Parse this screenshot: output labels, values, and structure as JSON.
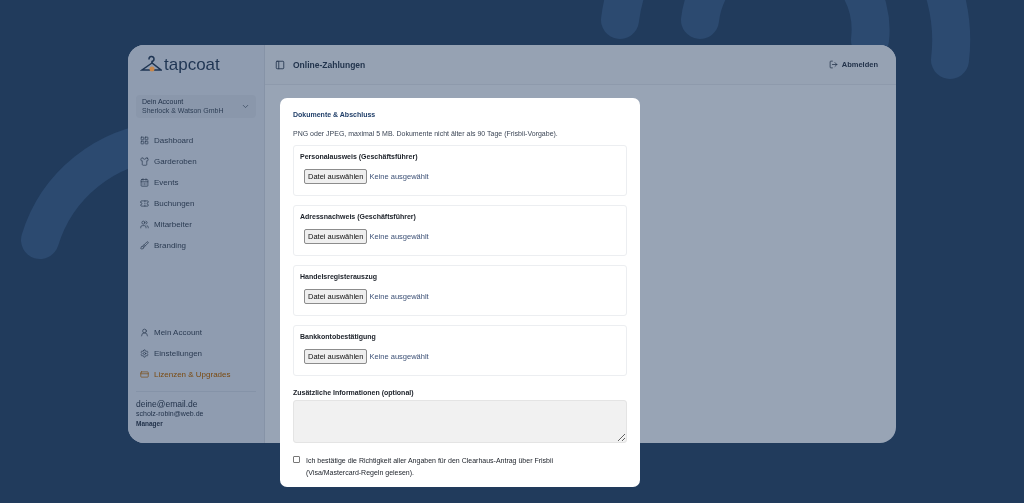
{
  "brand": {
    "name": "tapcoat"
  },
  "account": {
    "label": "Dein Account",
    "name": "Sherlock & Watson GmbH"
  },
  "nav": [
    {
      "label": "Dashboard",
      "selected": false
    },
    {
      "label": "Garderoben",
      "selected": false
    },
    {
      "label": "Events",
      "selected": false
    },
    {
      "label": "Buchungen",
      "selected": false
    },
    {
      "label": "Mitarbeiter",
      "selected": false
    },
    {
      "label": "Branding",
      "selected": false
    }
  ],
  "bottom_nav": [
    {
      "label": "Mein Account",
      "kind": "plain"
    },
    {
      "label": "Einstellungen",
      "kind": "plain"
    },
    {
      "label": "Lizenzen & Upgrades",
      "kind": "accent"
    }
  ],
  "user": {
    "email": "deine@email.de",
    "email_2": "scholz-robin@web.de",
    "role": "Manager"
  },
  "header": {
    "title": "Online-Zahlungen",
    "logout": "Abmelden"
  },
  "modal": {
    "title": "Dokumente & Abschluss",
    "hint": "PNG oder JPEG, maximal 5 MB. Dokumente nicht älter als 90 Tage (Frisbii-Vorgabe).",
    "documents": [
      {
        "label": "Personalausweis (Geschäftsführer)",
        "button": "Datei auswählen",
        "status": "Keine ausgewählt"
      },
      {
        "label": "Adressnachweis (Geschäftsführer)",
        "button": "Datei auswählen",
        "status": "Keine ausgewählt"
      },
      {
        "label": "Handelsregisterauszug",
        "button": "Datei auswählen",
        "status": "Keine ausgewählt"
      },
      {
        "label": "Bankkontobestätigung",
        "button": "Datei auswählen",
        "status": "Keine ausgewählt"
      }
    ],
    "notes": {
      "label": "Zusätzliche Informationen (optional)"
    },
    "confirm": {
      "checked": false,
      "text": "Ich bestätige die Richtigkeit aller Angaben für den Clearhaus-Antrag über Frisbii (Visa/Mastercard-Regeln gelesen)."
    }
  }
}
